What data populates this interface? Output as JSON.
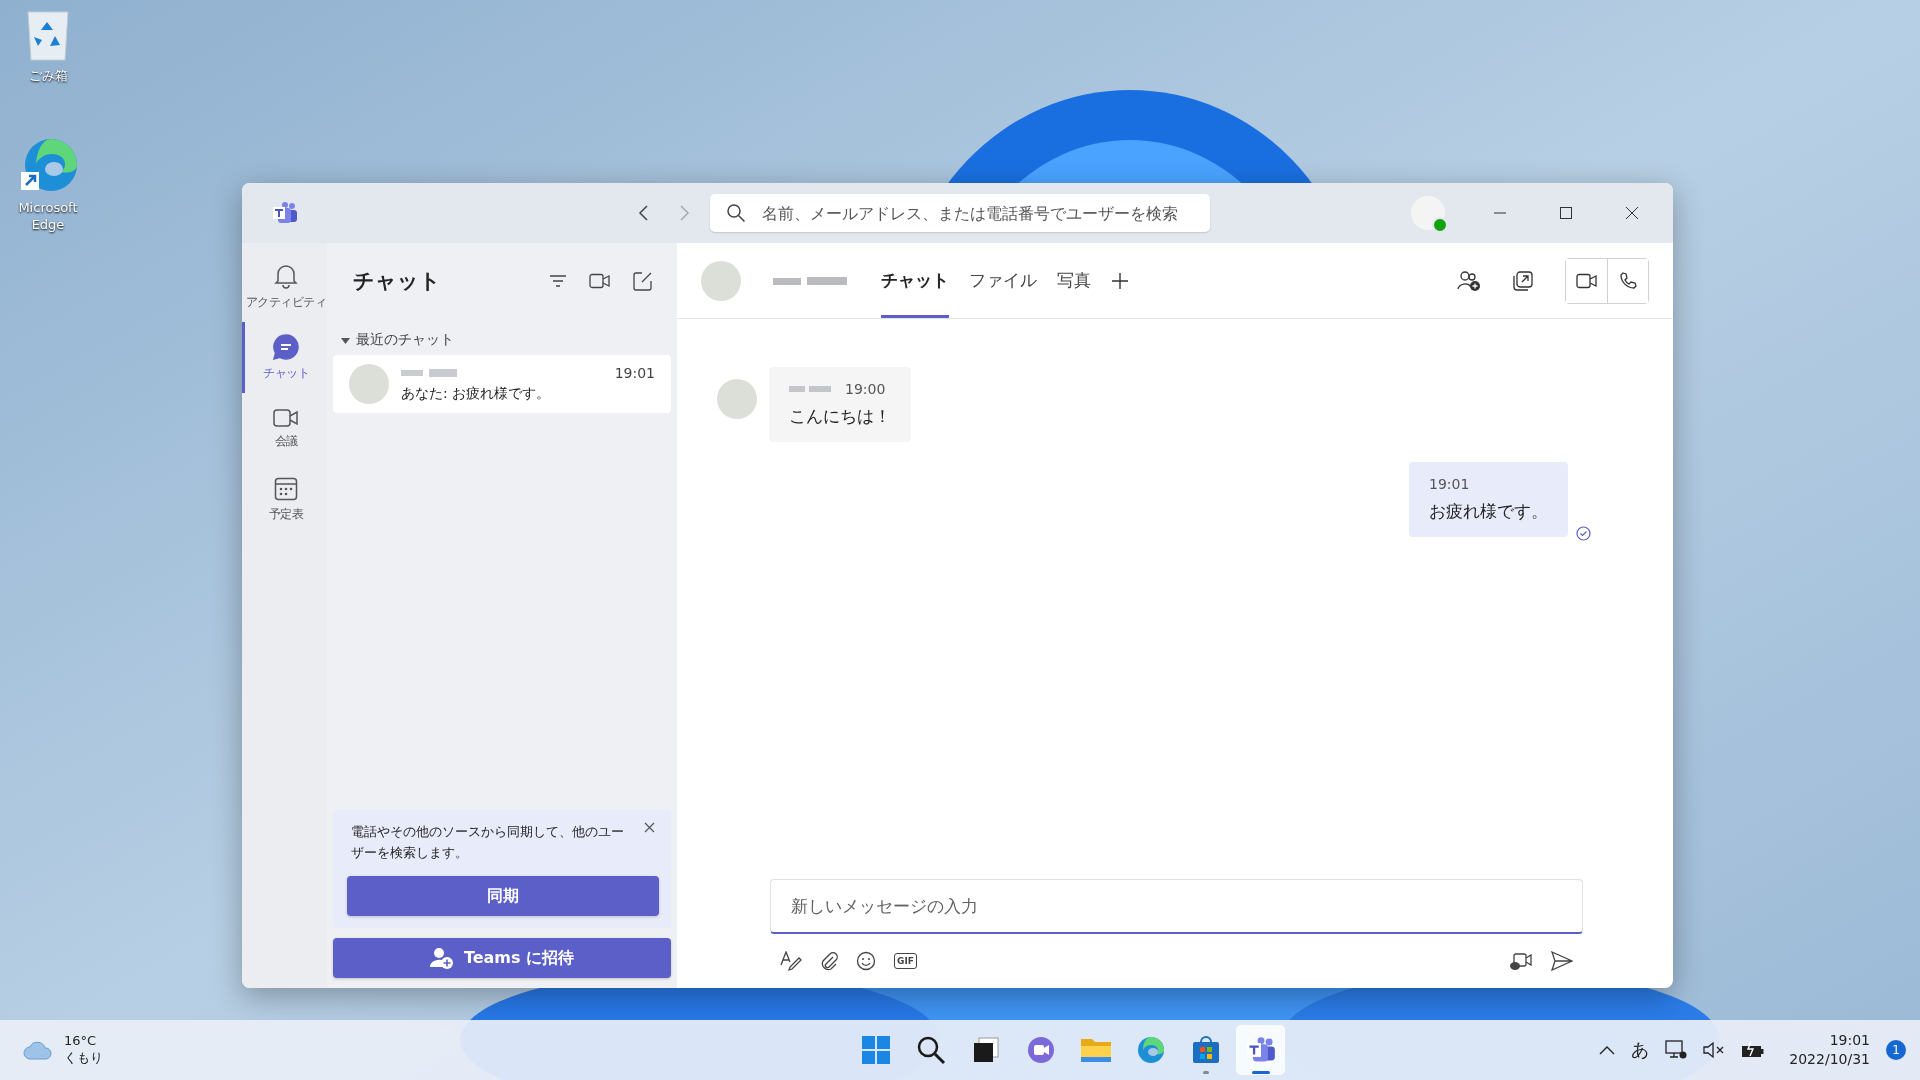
{
  "desktop_icons": [
    {
      "kind": "recycle",
      "label": "ごみ箱"
    },
    {
      "kind": "edge",
      "label": "Microsoft Edge"
    }
  ],
  "window": {
    "search": {
      "placeholder": "名前、メールアドレス、または電話番号でユーザーを検索"
    }
  },
  "rail": [
    {
      "kind": "bell",
      "label": "アクティビティ",
      "selected": false
    },
    {
      "kind": "chat",
      "label": "チャット",
      "selected": true
    },
    {
      "kind": "video",
      "label": "会議",
      "selected": false
    },
    {
      "kind": "calendar",
      "label": "予定表",
      "selected": false
    }
  ],
  "chat_list": {
    "title": "チャット",
    "section": {
      "label": "最近のチャット",
      "expanded": true
    },
    "items": [
      {
        "time": "19:01",
        "preview": "あなた: お疲れ様です。",
        "selected": true
      }
    ]
  },
  "sync_card": {
    "text": "電話やその他のソースから同期して、他のユーザーを検索します。",
    "button": "同期"
  },
  "invite_button": "Teams に招待",
  "conversation": {
    "tabs": [
      {
        "label": "チャット",
        "selected": true
      },
      {
        "label": "ファイル",
        "selected": false
      },
      {
        "label": "写真",
        "selected": false
      }
    ],
    "messages": [
      {
        "kind": "received",
        "time": "19:00",
        "text": "こんにちは！"
      },
      {
        "kind": "sent",
        "time": "19:01",
        "text": "お疲れ様です。"
      }
    ],
    "composer": {
      "placeholder": "新しいメッセージの入力"
    },
    "tools": [
      {
        "kind": "format"
      },
      {
        "kind": "attach"
      },
      {
        "kind": "emoji"
      },
      {
        "kind": "gif",
        "label": "GIF"
      }
    ]
  },
  "taskbar": {
    "weather": {
      "temp": "16°C",
      "condition": "くもり"
    },
    "apps": [
      {
        "kind": "start",
        "selected": false,
        "running": false
      },
      {
        "kind": "search",
        "selected": false,
        "running": false
      },
      {
        "kind": "taskview",
        "selected": false,
        "running": false
      },
      {
        "kind": "chat",
        "selected": false,
        "running": false
      },
      {
        "kind": "explorer",
        "selected": false,
        "running": false
      },
      {
        "kind": "edge",
        "selected": false,
        "running": false
      },
      {
        "kind": "store",
        "selected": false,
        "running": true
      },
      {
        "kind": "teams",
        "selected": true,
        "running": true
      }
    ],
    "ime": "あ",
    "time": "19:01",
    "date": "2022/10/31",
    "notifications": "1"
  }
}
